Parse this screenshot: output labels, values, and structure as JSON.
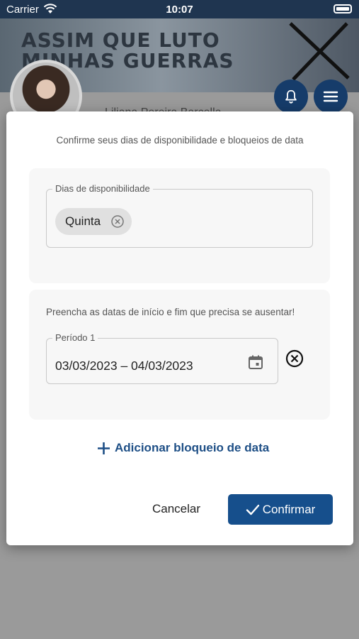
{
  "status_bar": {
    "carrier": "Carrier",
    "time": "10:07"
  },
  "background": {
    "banner_text": "ASSIM QUE LUTO\nMINHAS GUERRAS",
    "profile_name": "Liliana Pereira Barcella"
  },
  "dialog": {
    "subtitle": "Confirme seus dias de disponibilidade e bloqueios de data",
    "availability": {
      "legend": "Dias de disponibilidade",
      "chips": [
        "Quinta"
      ]
    },
    "date_block": {
      "hint": "Preencha as datas de início e fim que precisa se ausentar!",
      "period_label": "Período 1",
      "period_value": "03/03/2023 – 04/03/2023"
    },
    "add_block_label": "Adicionar bloqueio de data",
    "cancel_label": "Cancelar",
    "confirm_label": "Confirmar"
  },
  "colors": {
    "primary": "#164f8c",
    "status_bar": "#1f3550",
    "fab": "#163c6a"
  },
  "icons": [
    "wifi-icon",
    "battery-icon",
    "bell-icon",
    "menu-icon",
    "close-circle-icon",
    "calendar-icon",
    "plus-icon",
    "check-icon"
  ]
}
